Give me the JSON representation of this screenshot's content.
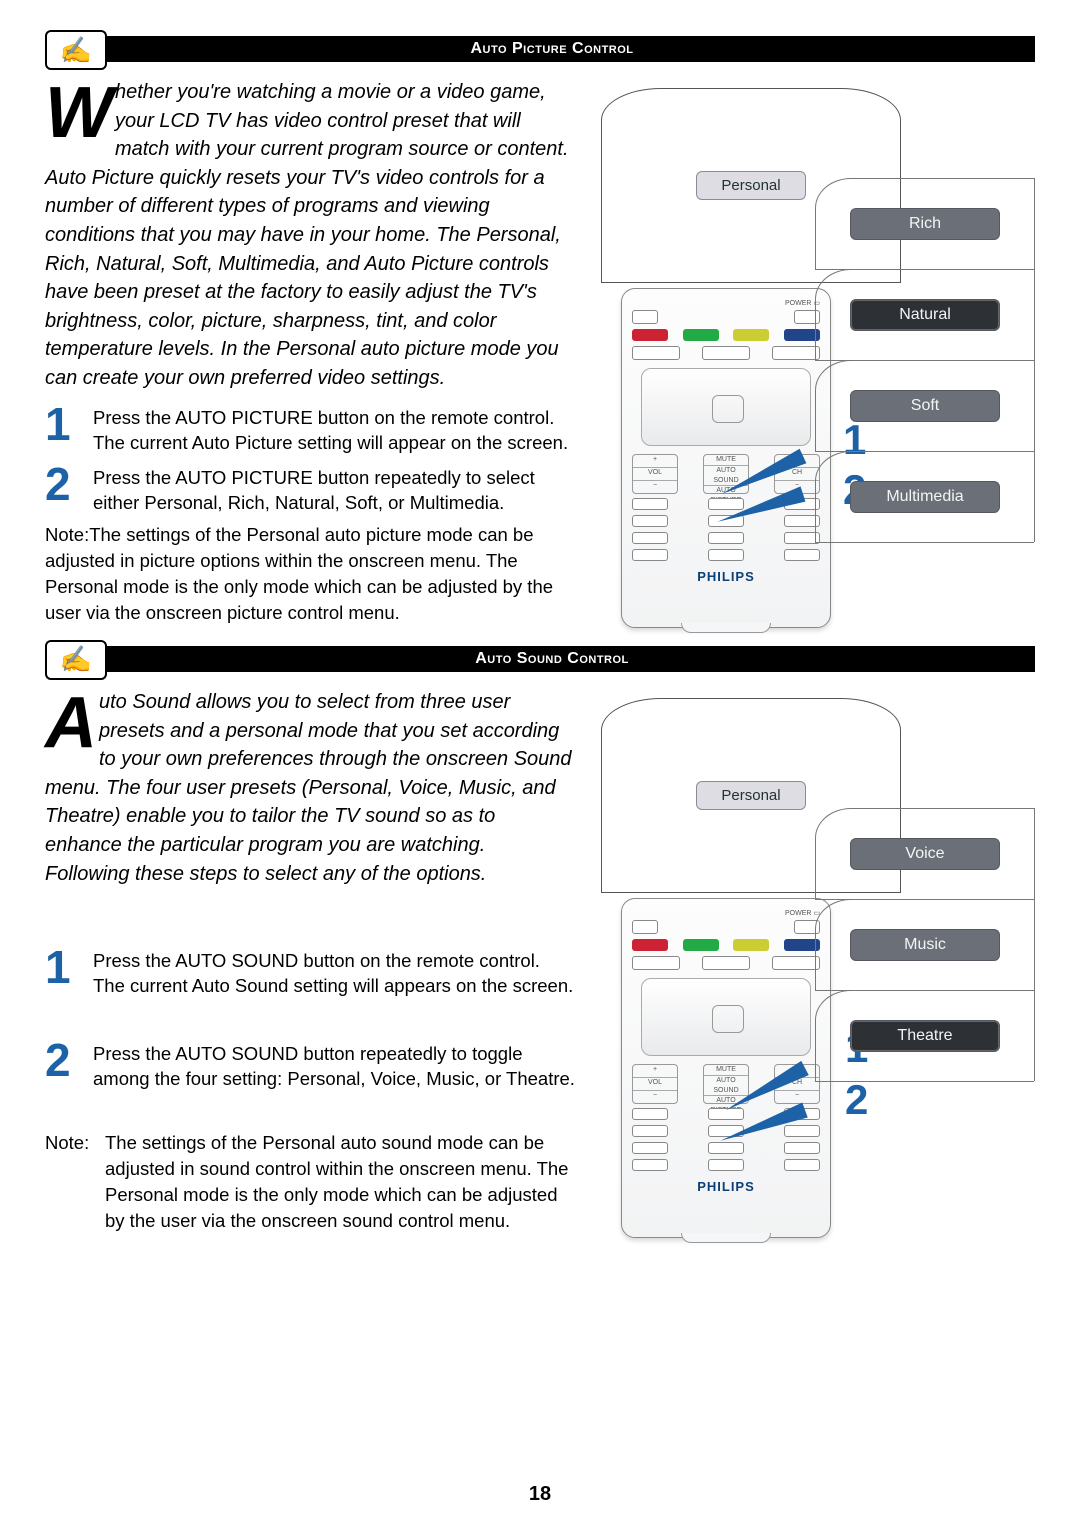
{
  "picture": {
    "header": "Auto Picture Control",
    "intro_dropcap": "W",
    "intro": "hether you're watching a movie or a video game, your LCD TV has video control preset that will match with your current program source or content. Auto Picture quickly resets your TV's video controls for a number of different types of programs and viewing conditions that you may have in your home. The Personal, Rich, Natural, Soft, Multimedia, and Auto Picture controls have been preset at the factory to easily adjust the TV's brightness, color, picture, sharpness, tint, and color temperature levels. In the Personal auto picture mode you can create your own preferred video settings.",
    "steps": [
      "Press the AUTO PICTURE button on the remote control. The current Auto Picture setting will appear on the screen.",
      "Press the AUTO PICTURE button repeatedly to select either Personal, Rich, Natural, Soft, or Multimedia."
    ],
    "step_nums": [
      "1",
      "2"
    ],
    "note_label": "Note:",
    "note": "The settings of the Personal auto picture mode can be adjusted in picture options within the onscreen menu. The Personal mode is the only mode which can be adjusted by the user via the onscreen picture control menu.",
    "tv_label": "Personal",
    "options": [
      "Rich",
      "Natural",
      "Soft",
      "Multimedia"
    ],
    "option_selected": "Natural",
    "remote_brand": "PHILIPS"
  },
  "sound": {
    "header": "Auto Sound Control",
    "intro_dropcap": "A",
    "intro": "uto Sound allows you to select from three user presets and a personal mode that you set according to your own preferences through the onscreen Sound menu. The four user presets (Personal, Voice, Music, and Theatre) enable you to tailor the TV sound so as to enhance the particular program you are watching. Following these steps to select any of the options.",
    "steps": [
      "Press the AUTO SOUND button on the remote control. The current Auto Sound setting will appears on the screen.",
      "Press the AUTO SOUND button repeatedly to toggle among the four setting: Personal, Voice, Music, or Theatre."
    ],
    "step_nums": [
      "1",
      "2"
    ],
    "note_label": "Note:",
    "note": "The settings of the Personal auto sound mode can be adjusted in sound control within the onscreen menu. The Personal  mode is the only mode which can be adjusted by the user via the onscreen sound control menu.",
    "tv_label": "Personal",
    "options": [
      "Voice",
      "Music",
      "Theatre"
    ],
    "option_selected": "Theatre",
    "remote_brand": "PHILIPS"
  },
  "page_number": "18",
  "note_icon_glyph": "✍",
  "callout_1": "1",
  "callout_2": "2"
}
